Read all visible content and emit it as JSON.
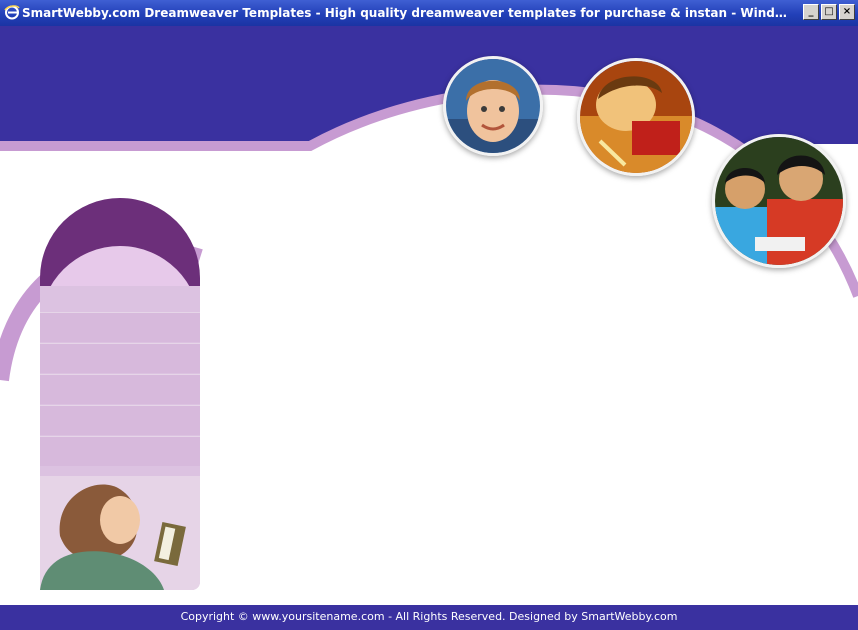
{
  "window": {
    "title": "SmartWebby.com Dreamweaver Templates - High quality dreamweaver templates for purchase & instan - Windows Interne...",
    "minimize_label": "_",
    "maximize_label": "□",
    "close_label": "×"
  },
  "footer": {
    "copyright": "Copyright © www.yoursitename.com - All Rights Reserved. Designed by SmartWebby.com"
  },
  "colors": {
    "header": "#3a31a0",
    "accent": "#c79bd2",
    "sidebar": "#dcc2e1",
    "arch": "#6c2f7a"
  },
  "icons": [
    "ie-icon"
  ],
  "photos": [
    "boy-portrait-photo",
    "girl-writing-photo",
    "kids-reading-photo",
    "woman-reading-photo"
  ]
}
